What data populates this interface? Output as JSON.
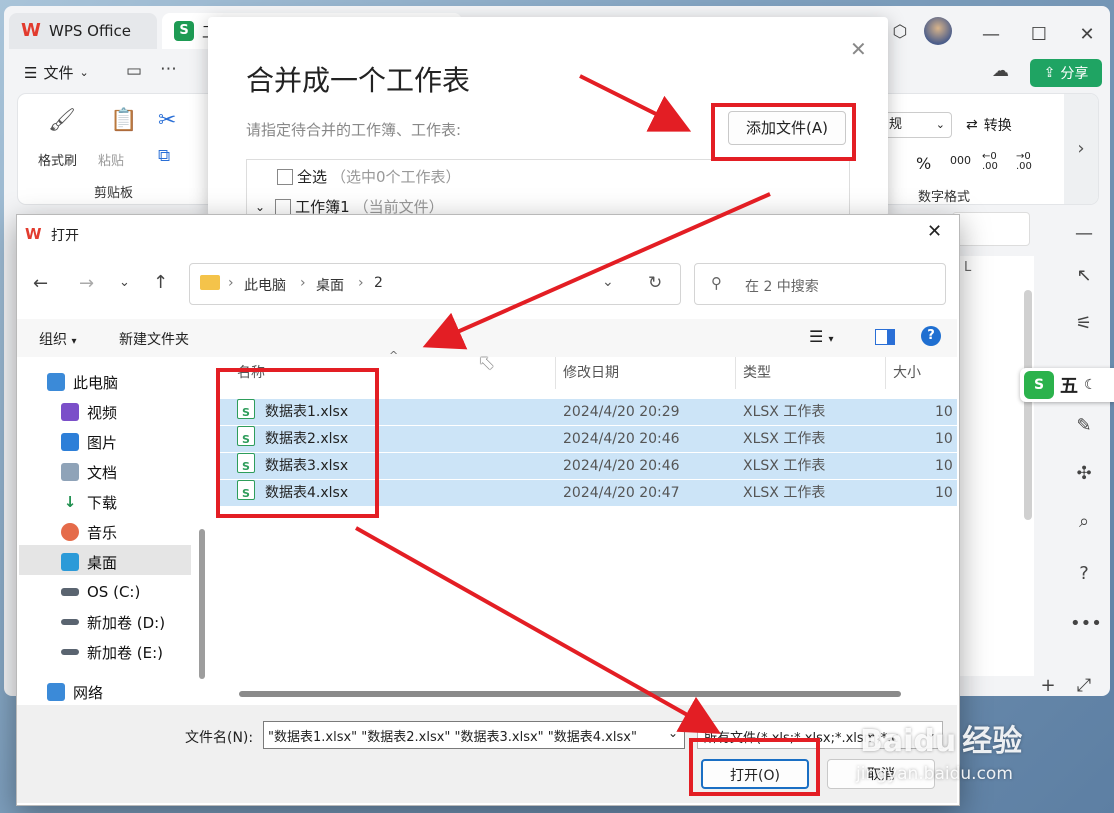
{
  "tabs": [
    {
      "label": "WPS Office"
    },
    {
      "label": "工"
    }
  ],
  "toolbar": {
    "file_menu": "文件",
    "share": "分享",
    "format_painter": "格式刷",
    "paste": "粘贴",
    "clipboard_group": "剪贴板",
    "convert": "转换",
    "number_format_group": "数字格式",
    "number_format_value": "规",
    "percent": "%",
    "thousands": "000",
    "decimal_inc": "←0 .00",
    "decimal_dec": "→0 .00"
  },
  "sheet": {
    "col_label": "L"
  },
  "ime": {
    "label": "五"
  },
  "merge_dialog": {
    "title": "合并成一个工作表",
    "subtitle": "请指定待合并的工作簿、工作表:",
    "add_file_button": "添加文件(A)",
    "select_all": "全选",
    "select_all_hint": "（选中0个工作表）",
    "workbook": "工作簿1",
    "workbook_hint": "（当前文件）"
  },
  "open_dialog": {
    "title": "打开",
    "breadcrumb": [
      "此电脑",
      "桌面",
      "2"
    ],
    "search_placeholder": "在 2 中搜索",
    "organize": "组织",
    "new_folder": "新建文件夹",
    "columns": [
      "名称",
      "修改日期",
      "类型",
      "大小"
    ],
    "files": [
      {
        "name": "数据表1.xlsx",
        "date": "2024/4/20 20:29",
        "type": "XLSX 工作表",
        "size": "10"
      },
      {
        "name": "数据表2.xlsx",
        "date": "2024/4/20 20:46",
        "type": "XLSX 工作表",
        "size": "10"
      },
      {
        "name": "数据表3.xlsx",
        "date": "2024/4/20 20:46",
        "type": "XLSX 工作表",
        "size": "10"
      },
      {
        "name": "数据表4.xlsx",
        "date": "2024/4/20 20:47",
        "type": "XLSX 工作表",
        "size": "10"
      }
    ],
    "sidebar": [
      {
        "label": "此电脑"
      },
      {
        "label": "视频"
      },
      {
        "label": "图片"
      },
      {
        "label": "文档"
      },
      {
        "label": "下载"
      },
      {
        "label": "音乐"
      },
      {
        "label": "桌面"
      },
      {
        "label": "OS (C:)"
      },
      {
        "label": "新加卷 (D:)"
      },
      {
        "label": "新加卷 (E:)"
      },
      {
        "label": "网络"
      }
    ],
    "filename_label": "文件名(N):",
    "filename_value": "\"数据表1.xlsx\" \"数据表2.xlsx\" \"数据表3.xlsx\" \"数据表4.xlsx\"",
    "filetype_value": "所有文件(*.xls;*.xlsx;*.xlsm;*.c",
    "open_button": "打开(O)",
    "cancel_button": "取消"
  },
  "watermark": {
    "brand": "Baidu",
    "product": "经验",
    "url": "jingyan.baidu.com"
  },
  "colors": {
    "accent_red": "#e31e24",
    "wps_green": "#1fa463",
    "selection": "#cce4f7"
  }
}
